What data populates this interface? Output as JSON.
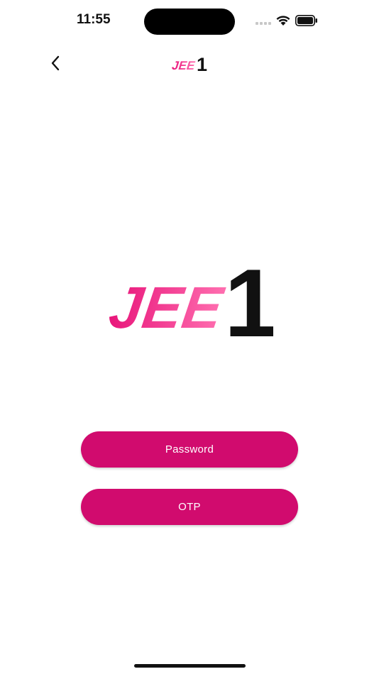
{
  "status_bar": {
    "time": "11:55",
    "icons": [
      "cellular-signal-icon",
      "wifi-icon",
      "battery-icon"
    ]
  },
  "nav": {
    "back_icon": "chevron-left-icon",
    "logo_text_main": "JEE",
    "logo_text_number": "1"
  },
  "logo": {
    "text_main": "JEE",
    "text_number": "1",
    "gradient_start": "#e8157a",
    "gradient_end": "#ff6fb0",
    "number_color": "#111111"
  },
  "actions": {
    "password_label": "Password",
    "otp_label": "OTP"
  },
  "colors": {
    "accent": "#d10b6e",
    "background": "#ffffff"
  }
}
